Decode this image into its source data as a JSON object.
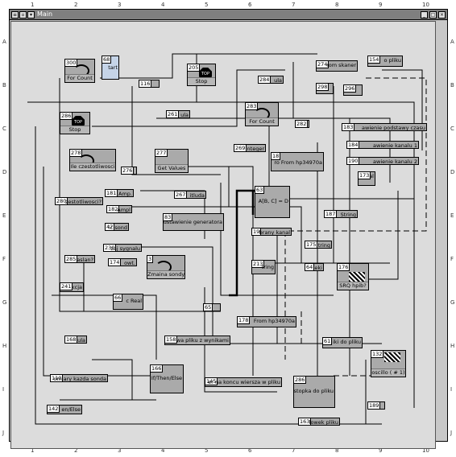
{
  "window": {
    "title": "Main",
    "column_ticks": [
      "1",
      "2",
      "3",
      "4",
      "5",
      "6",
      "7",
      "8",
      "9",
      "10"
    ],
    "row_ticks": [
      "A",
      "B",
      "C",
      "D",
      "E",
      "F",
      "G",
      "H",
      "I",
      "J"
    ]
  },
  "nodes": {
    "n300": {
      "id": "300",
      "label": "For Count"
    },
    "n68": {
      "id": "68",
      "label": "tart"
    },
    "n116": {
      "id": "116",
      "label": ""
    },
    "n205": {
      "id": "205",
      "label": "Stop",
      "icon": "TOP"
    },
    "n274": {
      "id": "274",
      "label": "rom skaner"
    },
    "n154": {
      "id": "154",
      "label": "o pliku"
    },
    "n284": {
      "id": "284",
      "label": "ula"
    },
    "n298": {
      "id": "298",
      "label": ""
    },
    "n296": {
      "id": "296",
      "label": ""
    },
    "n286a": {
      "id": "286",
      "label": "Stop",
      "icon": "TOP"
    },
    "n261": {
      "id": "261",
      "label": "ula"
    },
    "n283": {
      "id": "283",
      "label": "For Count"
    },
    "n282": {
      "id": "282",
      "label": ""
    },
    "n183": {
      "id": "183",
      "label": "awienie podstawy czasu"
    },
    "n184": {
      "id": "184",
      "label": "awienie kanalu 1"
    },
    "n278": {
      "id": "278",
      "label": "Ile czestotliwosci"
    },
    "n277": {
      "id": "277",
      "label": "Get Values"
    },
    "n276": {
      "id": "276",
      "label": ""
    },
    "n269": {
      "id": "269",
      "label": "Integer"
    },
    "n18": {
      "id": "18",
      "label": "ro From hp34970a"
    },
    "n190": {
      "id": "190",
      "label": "awienie kanalu 2"
    },
    "n173": {
      "id": "173",
      "label": "al"
    },
    "n181": {
      "id": "181",
      "label": "Amp."
    },
    "n280": {
      "id": "280",
      "label": "zestotliwosci?"
    },
    "n182": {
      "id": "182",
      "label": "Ampl"
    },
    "n267": {
      "id": "267",
      "label": "itluda"
    },
    "n63": {
      "id": "63",
      "label": "A[B, C] = D"
    },
    "n187": {
      "id": "187",
      "label": "String"
    },
    "n83": {
      "id": "83",
      "label": "ustawienie generatora"
    },
    "n47": {
      "id": "47",
      "label": "ic sond"
    },
    "n19": {
      "id": "19",
      "label": "brany kanal"
    },
    "n230": {
      "id": "230",
      "label": "zaj sygnalu"
    },
    "n285": {
      "id": "285",
      "label": "aslan?"
    },
    "n174": {
      "id": "174",
      "label": "owt."
    },
    "n3": {
      "id": "3",
      "label": "Zmaina sondy"
    },
    "n175": {
      "id": "175",
      "label": "tring"
    },
    "n213": {
      "id": "213",
      "label": "tring"
    },
    "n64": {
      "id": "64",
      "label": "eki"
    },
    "n176": {
      "id": "176",
      "label": "SRQ hpib?"
    },
    "n241": {
      "id": "241",
      "label": "kcja"
    },
    "n66": {
      "id": "66",
      "label": "c Real"
    },
    "n65": {
      "id": "65",
      "label": ""
    },
    "n178": {
      "id": "178",
      "label": "From hp34970a"
    },
    "n168": {
      "id": "168",
      "label": "ula"
    },
    "n158": {
      "id": "158",
      "label": "wa pliku z wynikami"
    },
    "n61": {
      "id": "61",
      "label": "iki do pliku"
    },
    "n132": {
      "id": "132",
      "label": "oscillo ( # 1)"
    },
    "n166": {
      "id": "166",
      "label": "If/Then/Else"
    },
    "n110": {
      "id": "110",
      "label": "omiary kazda sonda"
    },
    "n145": {
      "id": "145",
      "label": "er na koncu wiersza w pliku"
    },
    "n286b": {
      "id": "286",
      "label": "stopka do pliku"
    },
    "n142": {
      "id": "142",
      "label": "en/Else"
    },
    "n189": {
      "id": "189",
      "label": ""
    },
    "n163": {
      "id": "163",
      "label": "lowek pliku"
    }
  }
}
